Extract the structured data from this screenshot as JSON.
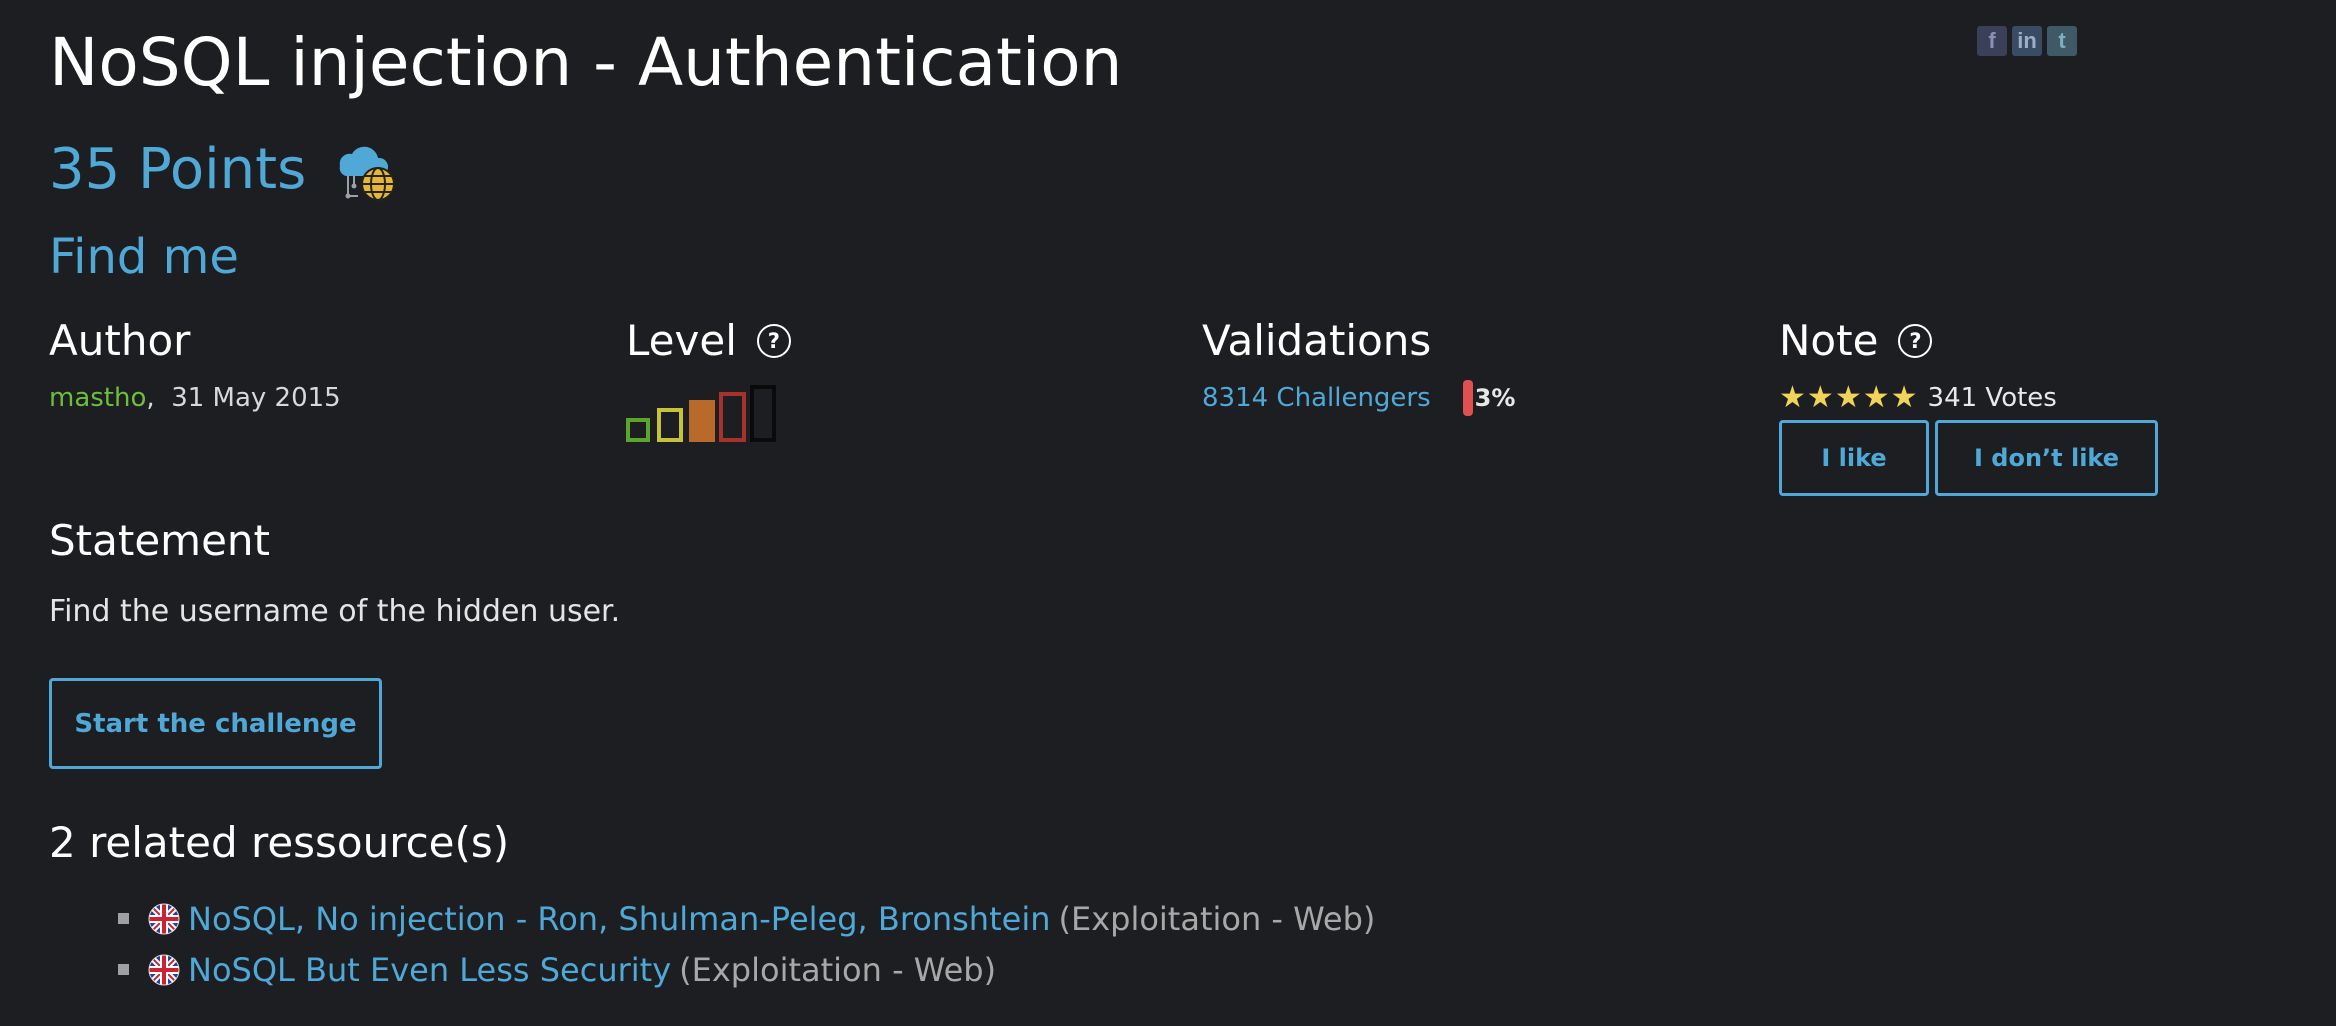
{
  "challenge": {
    "title": "NoSQL injection - Authentication",
    "points": "35 Points",
    "subtitle": "Find me",
    "category_icon": "cloud-network-globe-icon"
  },
  "social": {
    "facebook": "f",
    "linkedin": "in",
    "twitter": "t"
  },
  "author": {
    "heading": "Author",
    "name": "mastho",
    "separator": ",",
    "date": "31 May 2015"
  },
  "level": {
    "heading": "Level",
    "help": "?",
    "current": 3,
    "max": 5
  },
  "validations": {
    "heading": "Validations",
    "challengers": "8314 Challengers",
    "percent": "3%",
    "percent_value": 0.03
  },
  "note": {
    "heading": "Note",
    "help": "?",
    "stars": 5,
    "star_glyph": "★",
    "votes": "341 Votes",
    "like_label": "I like",
    "dislike_label": "I don’t like"
  },
  "statement": {
    "heading": "Statement",
    "text": "Find the username of the hidden user.",
    "start_label": "Start the challenge"
  },
  "related": {
    "heading": "2 related ressource(s)",
    "items": [
      {
        "title": "NoSQL, No injection - Ron, Shulman-Peleg, Bronshtein",
        "category": "(Exploitation - Web)",
        "flag": "uk-flag-icon"
      },
      {
        "title": "NoSQL But Even Less Security",
        "category": "(Exploitation - Web)",
        "flag": "uk-flag-icon"
      }
    ]
  },
  "colors": {
    "background": "#1d1e22",
    "accent": "#4fa8d6",
    "author_green": "#6cbf3a",
    "star_yellow": "#f2d35a",
    "progress_red": "#e05050"
  }
}
